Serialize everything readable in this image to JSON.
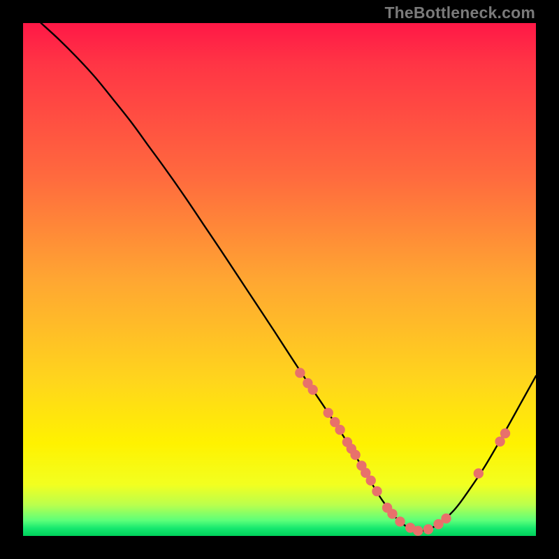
{
  "watermark": {
    "text": "TheBottleneck.com"
  },
  "chart_data": {
    "type": "line",
    "title": "",
    "xlabel": "",
    "ylabel": "",
    "xlim": [
      0,
      1
    ],
    "ylim": [
      0,
      1
    ],
    "grid": false,
    "series": [
      {
        "name": "bottleneck-curve",
        "x": [
          0.0,
          0.035,
          0.07,
          0.105,
          0.14,
          0.175,
          0.21,
          0.245,
          0.28,
          0.315,
          0.35,
          0.385,
          0.42,
          0.455,
          0.49,
          0.525,
          0.56,
          0.595,
          0.63,
          0.665,
          0.7,
          0.735,
          0.77,
          0.805,
          0.84,
          0.87,
          0.9,
          0.935,
          0.97,
          1.0
        ],
        "y": [
          null,
          1.0,
          0.968,
          0.933,
          0.895,
          0.852,
          0.808,
          0.76,
          0.712,
          0.662,
          0.61,
          0.558,
          0.505,
          0.452,
          0.399,
          0.345,
          0.292,
          0.24,
          0.186,
          0.128,
          0.07,
          0.028,
          0.01,
          0.02,
          0.05,
          0.09,
          0.135,
          0.195,
          0.258,
          0.312
        ]
      }
    ],
    "points": {
      "name": "highlighted-samples",
      "x": [
        0.54,
        0.555,
        0.565,
        0.595,
        0.608,
        0.618,
        0.632,
        0.64,
        0.648,
        0.66,
        0.668,
        0.678,
        0.69,
        0.71,
        0.72,
        0.735,
        0.755,
        0.77,
        0.79,
        0.81,
        0.825,
        0.888,
        0.93,
        0.94
      ],
      "y": [
        0.318,
        0.298,
        0.285,
        0.24,
        0.222,
        0.207,
        0.183,
        0.17,
        0.158,
        0.137,
        0.123,
        0.108,
        0.087,
        0.055,
        0.043,
        0.028,
        0.016,
        0.01,
        0.013,
        0.023,
        0.034,
        0.122,
        0.184,
        0.2
      ]
    },
    "colors": {
      "curve_stroke": "#000000",
      "point_fill": "#e8716b",
      "gradient_top": "#ff1846",
      "gradient_bottom": "#00d05b"
    }
  }
}
